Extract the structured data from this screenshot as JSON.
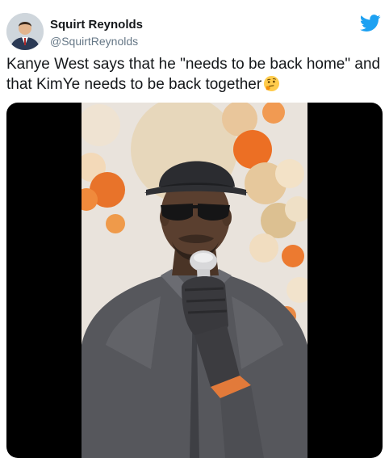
{
  "author": {
    "display_name": "Squirt Reynolds",
    "handle": "@SquirtReynolds"
  },
  "tweet": {
    "text": "Kanye West says that he \"needs to be back home\" and that KimYe needs to be back together",
    "emoji": "thinking-face"
  },
  "icons": {
    "logo": "twitter-bird-icon"
  },
  "colors": {
    "brand": "#1da1f2",
    "name": "#14171a",
    "handle": "#657786"
  }
}
